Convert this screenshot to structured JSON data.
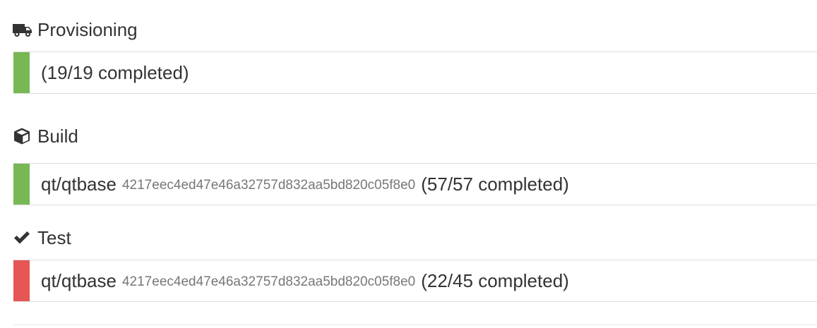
{
  "colors": {
    "success": "#77b855",
    "failure": "#e55654",
    "text": "#333333",
    "muted": "#777777"
  },
  "sections": [
    {
      "title": "Provisioning",
      "icon": "truck-icon",
      "row": {
        "status": "success",
        "repo": "",
        "sha": "",
        "progress": "(19/19 completed)",
        "completed": 19,
        "total": 19
      }
    },
    {
      "title": "Build",
      "icon": "cube-icon",
      "row": {
        "status": "success",
        "repo": "qt/qtbase",
        "sha": "4217eec4ed47e46a32757d832aa5bd820c05f8e0",
        "progress": "(57/57 completed)",
        "completed": 57,
        "total": 57
      }
    },
    {
      "title": "Test",
      "icon": "check-icon",
      "row": {
        "status": "failure",
        "repo": "qt/qtbase",
        "sha": "4217eec4ed47e46a32757d832aa5bd820c05f8e0",
        "progress": "(22/45 completed)",
        "completed": 22,
        "total": 45
      }
    }
  ]
}
